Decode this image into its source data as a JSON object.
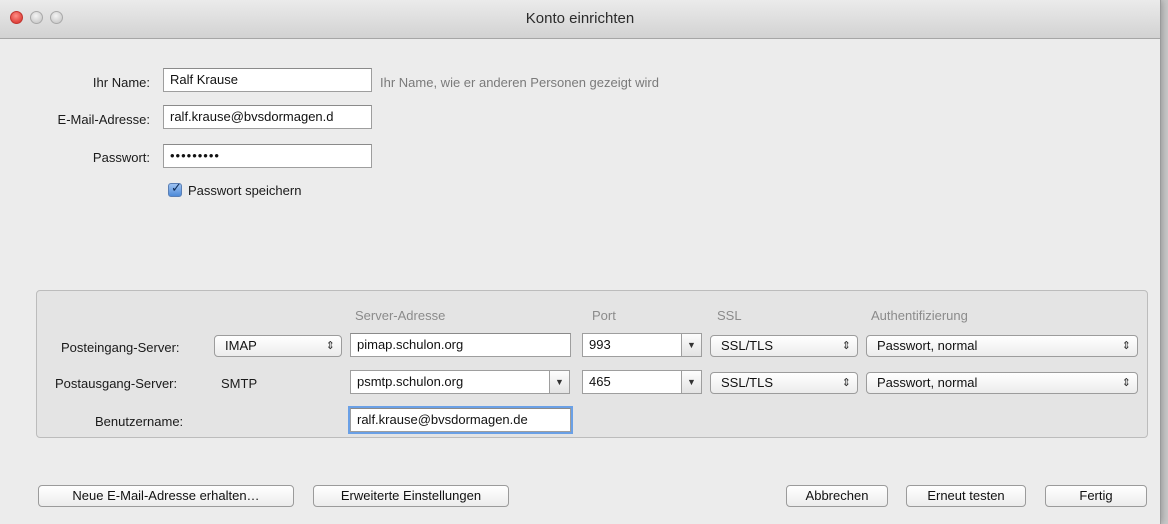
{
  "window": {
    "title": "Konto einrichten"
  },
  "identity": {
    "name_label": "Ihr Name:",
    "name_value": "Ralf Krause",
    "name_hint": "Ihr Name, wie er anderen Personen gezeigt wird",
    "email_label": "E-Mail-Adresse:",
    "email_value": "ralf.krause@bvsdormagen.d",
    "password_label": "Passwort:",
    "password_value": "•••••••••",
    "remember_label": "Passwort speichern",
    "remember_checked": true
  },
  "server": {
    "columns": {
      "address": "Server-Adresse",
      "port": "Port",
      "ssl": "SSL",
      "auth": "Authentifizierung"
    },
    "incoming": {
      "label": "Posteingang-Server:",
      "protocol": "IMAP",
      "address": "pimap.schulon.org",
      "port": "993",
      "ssl": "SSL/TLS",
      "auth": "Passwort, normal"
    },
    "outgoing": {
      "label": "Postausgang-Server:",
      "protocol": "SMTP",
      "address": "psmtp.schulon.org",
      "port": "465",
      "ssl": "SSL/TLS",
      "auth": "Passwort, normal"
    },
    "username": {
      "label": "Benutzername:",
      "value": "ralf.krause@bvsdormagen.de"
    }
  },
  "buttons": {
    "new_address": "Neue E-Mail-Adresse erhalten…",
    "advanced": "Erweiterte Einstellungen",
    "cancel": "Abbrechen",
    "retest": "Erneut testen",
    "done": "Fertig"
  },
  "icons": {
    "close": "close-icon",
    "minimize": "minimize-icon",
    "maximize": "maximize-icon",
    "checkbox": "checkmark-icon",
    "updown": "updown-arrows-icon",
    "dropdown": "dropdown-arrow-icon"
  }
}
